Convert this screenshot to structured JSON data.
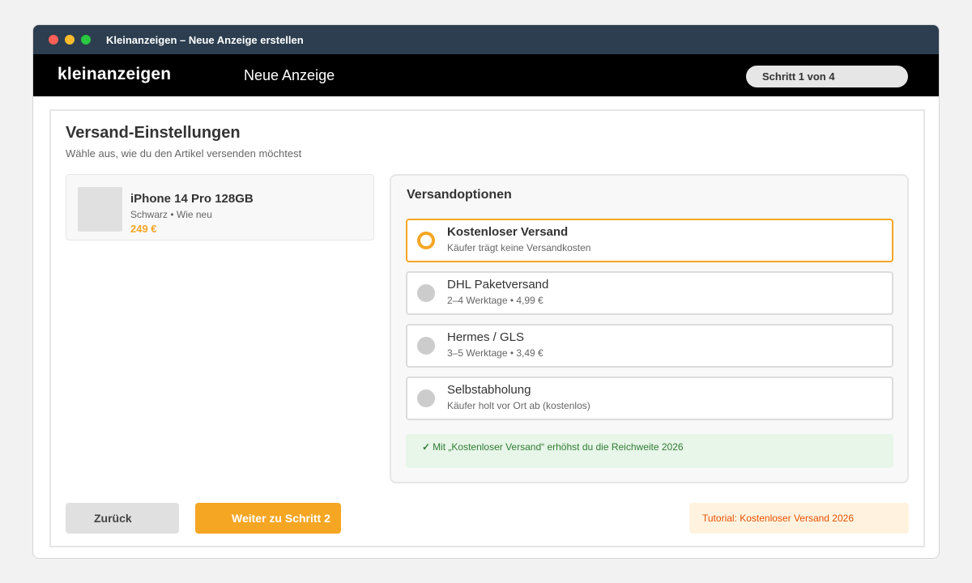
{
  "window": {
    "title": "Kleinanzeigen – Neue Anzeige erstellen"
  },
  "appbar": {
    "logo": "kleinanzeigen",
    "title": "Neue Anzeige",
    "step": "Schritt 1 von 4"
  },
  "page": {
    "heading": "Versand-Einstellungen",
    "subheading": "Wähle aus, wie du den Artikel versenden möchtest"
  },
  "product": {
    "name": "iPhone 14 Pro 128GB",
    "meta": "Schwarz • Wie neu",
    "price": "249 €"
  },
  "shipping": {
    "title": "Versandoptionen",
    "options": [
      {
        "label": "Kostenloser Versand",
        "desc": "Käufer trägt keine Versandkosten",
        "selected": true
      },
      {
        "label": "DHL Paketversand",
        "desc": "2–4 Werktage • 4,99 €",
        "selected": false
      },
      {
        "label": "Hermes / GLS",
        "desc": "3–5 Werktage • 3,49 €",
        "selected": false
      },
      {
        "label": "Selbstabholung",
        "desc": "Käufer holt vor Ort ab (kostenlos)",
        "selected": false
      }
    ],
    "hint_icon": "✓",
    "hint": "Mit „Kostenloser Versand“ erhöhst du die Reichweite 2026"
  },
  "actions": {
    "back_label": "Zurück",
    "next_label": "Weiter zu Schritt 2",
    "tutorial_label": "Tutorial: Kostenloser Versand 2026"
  },
  "colors": {
    "accent": "#f5a623",
    "titlebar": "#2c3e50",
    "appbar": "#000000",
    "hint_bg": "#e8f5e9",
    "hint_text": "#2e7d32",
    "tutorial_bg": "#fff3e0",
    "tutorial_text": "#e65100"
  }
}
